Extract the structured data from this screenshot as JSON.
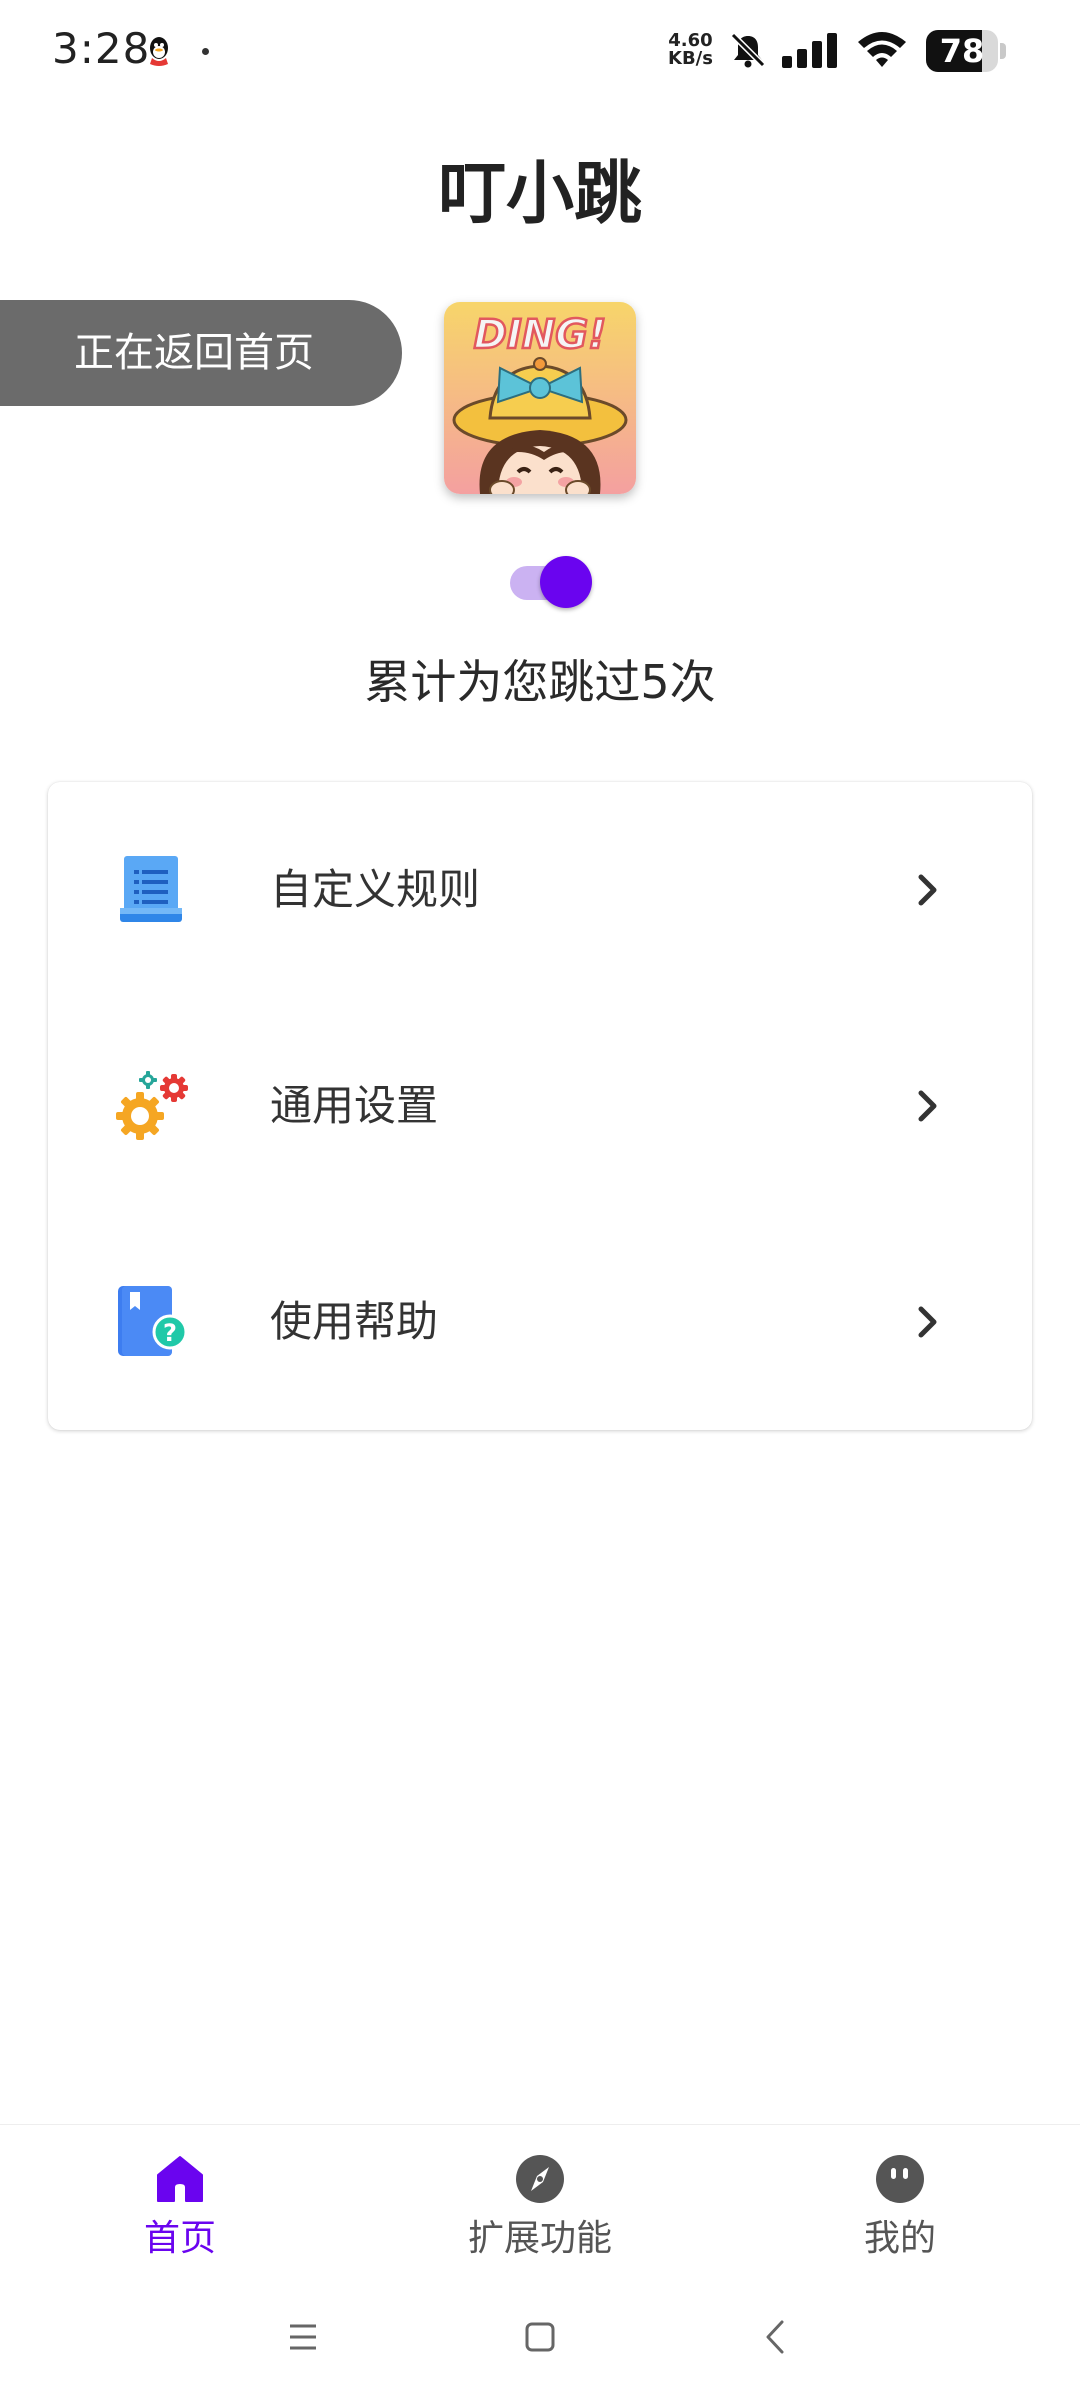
{
  "status_bar": {
    "time": "3:28",
    "net_speed_value": "4.60",
    "net_speed_unit": "KB/s",
    "battery": "78",
    "battery_level": 0.78,
    "icons": [
      "qq-icon",
      "notification-dot",
      "mute-bell-icon",
      "signal-icon",
      "wifi-icon",
      "battery-icon"
    ]
  },
  "header": {
    "title": "叮小跳"
  },
  "toast": {
    "text": "正在返回首页"
  },
  "logo": {
    "text": "DING!"
  },
  "service_switch": {
    "on": true
  },
  "counter_text": "累计为您跳过5次",
  "menu": {
    "items": [
      {
        "label": "自定义规则",
        "icon": "document-list-icon"
      },
      {
        "label": "通用设置",
        "icon": "gears-icon"
      },
      {
        "label": "使用帮助",
        "icon": "help-book-icon"
      }
    ]
  },
  "bottom_nav": {
    "items": [
      {
        "label": "首页",
        "icon": "home-icon",
        "active": true
      },
      {
        "label": "扩展功能",
        "icon": "compass-icon",
        "active": false
      },
      {
        "label": "我的",
        "icon": "profile-face-icon",
        "active": false
      }
    ]
  },
  "colors": {
    "accent": "#6a04ef",
    "accent_light": "#cbb2f2",
    "toast_bg": "#6b6b6b",
    "text_primary": "#222222"
  }
}
